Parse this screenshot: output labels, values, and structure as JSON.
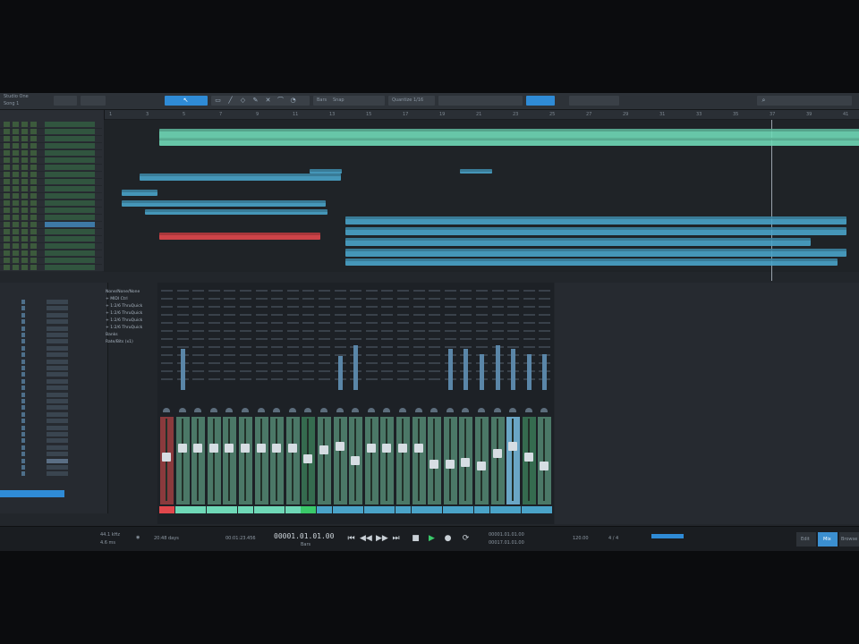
{
  "app": {
    "title": "Studio One",
    "song": "Song 1"
  },
  "colors": {
    "accent": "#2f8bd6",
    "clip_teal": "#6fd8b7",
    "clip_blue": "#4aa3c8",
    "clip_red": "#e0474c",
    "fader_green": "#4b7867",
    "fader_blue": "#6aa6c6"
  },
  "toolbar": {
    "tools": [
      "arrow-icon",
      "range-icon",
      "split-icon",
      "eraser-icon",
      "pencil-icon",
      "mute-tool-icon",
      "bend-icon",
      "listen-icon"
    ],
    "labels": [
      "Bars",
      "Snap",
      "Quantize 1/16"
    ]
  },
  "ruler": {
    "ticks": [
      "1",
      "3",
      "5",
      "7",
      "9",
      "11",
      "13",
      "15",
      "17",
      "19",
      "21",
      "23",
      "25",
      "27",
      "29",
      "31",
      "33",
      "35",
      "37",
      "39",
      "41"
    ]
  },
  "mixer": {
    "io_items": [
      "None/None/None",
      "+ MIDI Ctrl",
      "+ 1:2/6 ThruQuick",
      "+ 1:2/6 ThruQuick",
      "+ 1:2/6 ThruQuick",
      "+ 1:2/6 ThruQuick",
      "Banks",
      "Rate/Bits (x1)"
    ],
    "channel_count": 25
  },
  "transport": {
    "sample_rate": "44.1 kHz",
    "latency": "4.6 ms",
    "record_time": "20:48 days",
    "seconds": "00:01:23.456",
    "position": "00001.01.01.00",
    "position_label": "Bars",
    "loop_start": "00001.01.01.00",
    "loop_end": "00017.01.01.00",
    "tempo": "120.00",
    "signature": "4 / 4",
    "buttons": [
      "Edit",
      "Mix",
      "Browse"
    ]
  }
}
